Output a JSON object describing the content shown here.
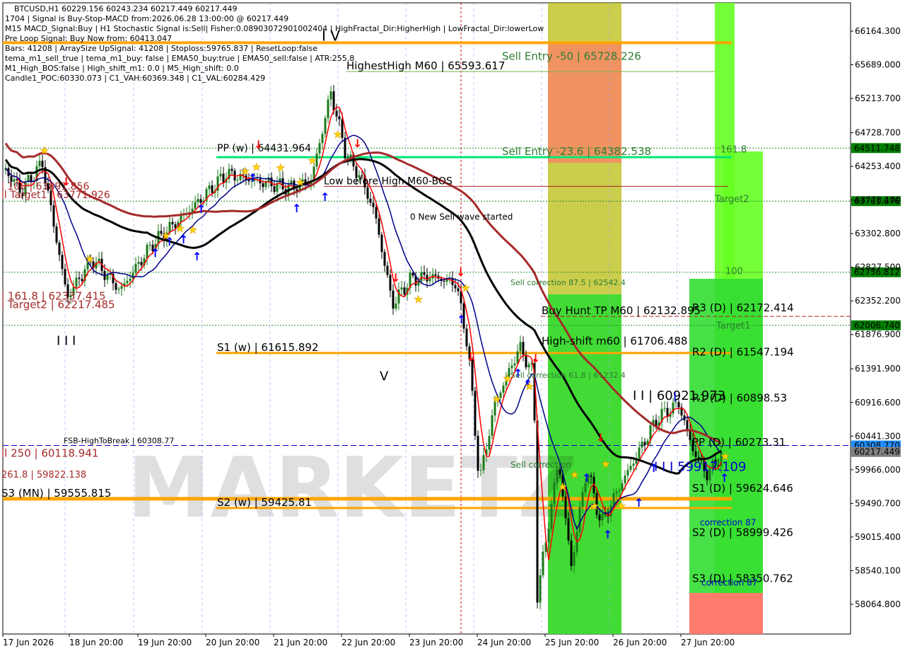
{
  "colors": {
    "background": "#ffffff",
    "bull": "#1a7a1a",
    "bear": "#000000",
    "red": "#ff0000",
    "navy": "#00008b",
    "black": "#000000",
    "brown": "#a52a2a",
    "orange": "#ffa500",
    "green_zone": "#33dd33",
    "lime_zone": "#66ff22",
    "olive_zone": "#b5b800",
    "salmon_zone": "#ff7b6b",
    "green_line": "#00e676",
    "olive_line": "#7cb342",
    "dark_green_text": "#2e7d32",
    "brown_text": "#a52a2a",
    "blue": "#0000cd",
    "dark_red": "#b22222",
    "price_bg": "#1e90ff"
  },
  "info_lines": [
    "1704 | Signal is Buy-Stop-MACD from:2026.06.28 13:00:00 @ 60217.449",
    "M15 MACD_Signal:Buy | H1 Stochastic Signal is:Sell| Fisher:0.08903072901002404 | HighFractal_Dir:HigherHigh | LowFractal_Dir:lowerLow",
    "Pre Loop Signal: Buy Now from: 60413.047",
    "Bars: 41208 | ArraySize UpSignal: 41208 | Stoploss:59765.837 | ResetLoop:false",
    "tema_m1_sell_true | tema_m1_buy: false | EMA50_buy:true | EMA50_sell:false | ATR:255.8",
    "M1_High_BOS:false | High_shift_m1: 0.0 | M5_High_shift: 0.0",
    "Candle1_POC:60330.073 | C1_VAH:60369.348 | C1_VAL:60284.429"
  ],
  "chart_data": {
    "type": "candlestick",
    "title": "BTCUSD,H1  60229.156 60243.234 60217.449 60217.449",
    "ylim": [
      57840,
      66500
    ],
    "y_ticks": [
      66164.3,
      65689.0,
      65213.7,
      64728.7,
      64253.4,
      63778.1,
      63302.8,
      62827.5,
      62352.2,
      61876.9,
      61391.9,
      60916.6,
      60441.3,
      59966.0,
      59490.7,
      59015.4,
      58540.1,
      58064.8
    ],
    "y_tick_labels": [
      "66164.300",
      "65689.000",
      "65213.700",
      "64728.700",
      "64253.400",
      "63778.100",
      "63302.800",
      "62827.500",
      "62352.200",
      "61876.900",
      "61391.900",
      "60916.600",
      "60441.300",
      "59966.000",
      "59490.700",
      "59015.400",
      "58540.100",
      "58064.800"
    ],
    "x_labels": [
      "17 Jun 2026",
      "18 Jun 20:00",
      "19 Jun 20:00",
      "20 Jun 20:00",
      "21 Jun 20:00",
      "22 Jun 20:00",
      "23 Jun 20:00",
      "24 Jun 20:00",
      "25 Jun 20:00",
      "26 Jun 20:00",
      "27 Jun 20:00"
    ],
    "price_tags": [
      {
        "label": "64511.748",
        "value": 64511.748,
        "color": "#008000"
      },
      {
        "label": "63761.676",
        "value": 63761.676,
        "color": "#008000"
      },
      {
        "label": "62756.812",
        "value": 62756.812,
        "color": "#008000"
      },
      {
        "label": "62006.740",
        "value": 62006.74,
        "color": "#008000"
      },
      {
        "label": "60308.770",
        "value": 60308.77,
        "color": "#1e90ff"
      },
      {
        "label": "60217.449",
        "value": 60217.449,
        "color": "#808080"
      }
    ],
    "level_texts": [
      {
        "text": "HighestHigh   M60 | 65593.617",
        "value": 65593.617,
        "color": "#000000"
      },
      {
        "text": "Sell Entry -50 | 65728.226",
        "value": 65728.226,
        "color": "#2e7d32"
      },
      {
        "text": "PP (w) | 64431.964",
        "value": 64431.964,
        "color": "#000000"
      },
      {
        "text": "Sell Entry -23.6 | 64382.538",
        "value": 64382.538,
        "color": "#2e7d32"
      },
      {
        "text": "Low before High   M60-BOS",
        "value": 63970,
        "color": "#000000"
      },
      {
        "text": "l 100 | 63891.856",
        "value": 63891.856,
        "color": "#a52a2a"
      },
      {
        "text": "ll Target1 | 63771.926",
        "value": 63771.926,
        "color": "#a52a2a"
      },
      {
        "text": "0 New Sell wave started",
        "value": 63470,
        "color": "#000000"
      },
      {
        "text": "Sell correction 87.5 | 62542.4",
        "value": 62542.4,
        "color": "#2e7d32"
      },
      {
        "text": "Buy Hunt TP M60 | 62132.895",
        "value": 62132.895,
        "color": "#000000"
      },
      {
        "text": "R3 (D) | 62172.414",
        "value": 62172.414,
        "color": "#000000"
      },
      {
        "text": "l 161.8 | 62337.415",
        "value": 62337.415,
        "color": "#a52a2a"
      },
      {
        "text": "l Target2 | 62217.485",
        "value": 62217.485,
        "color": "#a52a2a"
      },
      {
        "text": "High-shift m60 | 61706.488",
        "value": 61706.488,
        "color": "#000000"
      },
      {
        "text": "S1 (w) | 61615.892",
        "value": 61615.892,
        "color": "#000000"
      },
      {
        "text": "R2 (D) | 61547.194",
        "value": 61547.194,
        "color": "#000000"
      },
      {
        "text": "I I | 60921.973",
        "value": 60921.973,
        "color": "#000000"
      },
      {
        "text": "Sell correction 61.8 | 61232.4",
        "value": 61232.4,
        "color": "#2e7d32"
      },
      {
        "text": "R1 (D) | 60898.53",
        "value": 60898.53,
        "color": "#000000"
      },
      {
        "text": "FSB-HighToBreak | 60308.77",
        "value": 60308.77,
        "color": "#000000"
      },
      {
        "text": "PP (D) | 60273.31",
        "value": 60273.31,
        "color": "#000000"
      },
      {
        "text": "ll  250 | 60118.941",
        "value": 60118.941,
        "color": "#a52a2a"
      },
      {
        "text": "Sell correction",
        "value": 59966,
        "color": "#2e7d32"
      },
      {
        "text": "261.8 | 59822.138",
        "value": 59822.138,
        "color": "#a52a2a"
      },
      {
        "text": "S3 (MN) | 59555.815",
        "value": 59555.815,
        "color": "#000000"
      },
      {
        "text": "S1 (D) | 59624.646",
        "value": 59624.646,
        "color": "#000000"
      },
      {
        "text": "I I I 59917.109",
        "value": 59917.109,
        "color": "#0000cd"
      },
      {
        "text": "S2 (w) | 59425.81",
        "value": 59425.81,
        "color": "#000000"
      },
      {
        "text": "S2 (D) | 58999.426",
        "value": 58999.426,
        "color": "#000000"
      },
      {
        "text": "S3 (D) | 58350.762",
        "value": 58350.762,
        "color": "#000000"
      },
      {
        "text": "161.8",
        "value": 64420,
        "color": "#2e7d32"
      },
      {
        "text": "Target2",
        "value": 63720,
        "color": "#2e7d32"
      },
      {
        "text": "100",
        "value": 62700,
        "color": "#2e7d32"
      },
      {
        "text": "Target1",
        "value": 61930,
        "color": "#2e7d32"
      },
      {
        "text": "correction 87",
        "value": 58300,
        "color": "#0000cd"
      },
      {
        "text": "correction 87",
        "value": 59150,
        "color": "#0000cd"
      },
      {
        "text": "I I I",
        "value": 61700,
        "color": "#000000"
      },
      {
        "text": "V",
        "value": 61200,
        "color": "#000000"
      },
      {
        "text": "I V",
        "value": 66000,
        "color": "#000000"
      },
      {
        "text": "I",
        "value": 60900,
        "color": "#0000cd"
      }
    ],
    "watermark": "MARKETZ"
  }
}
